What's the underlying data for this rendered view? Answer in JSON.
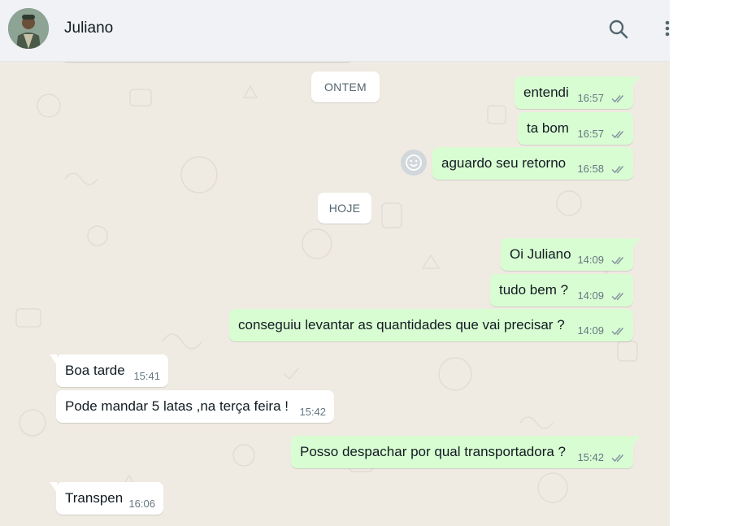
{
  "header": {
    "contact_name": "Juliano"
  },
  "icons": {
    "search": "search-icon",
    "menu": "kebab-menu-icon",
    "read_receipt": "double-check-icon",
    "emoji": "smiley-icon"
  },
  "colors": {
    "outgoing_bubble": "#d9fdd3",
    "incoming_bubble": "#ffffff",
    "chat_background": "#efeae2",
    "header_background": "#f0f2f5",
    "read_check": "#8696a0"
  },
  "dates": {
    "yesterday": "ONTEM",
    "today": "HOJE"
  },
  "messages": [
    {
      "direction": "out",
      "text": "entendi",
      "time": "16:57",
      "status": "read"
    },
    {
      "direction": "out",
      "text": "ta bom",
      "time": "16:57",
      "status": "read"
    },
    {
      "direction": "out",
      "text": "aguardo seu retorno",
      "time": "16:58",
      "status": "read"
    },
    {
      "direction": "out",
      "text": "Oi Juliano",
      "time": "14:09",
      "status": "read"
    },
    {
      "direction": "out",
      "text": "tudo bem ?",
      "time": "14:09",
      "status": "read"
    },
    {
      "direction": "out",
      "text": "conseguiu levantar as quantidades que vai precisar ?",
      "time": "14:09",
      "status": "read"
    },
    {
      "direction": "in",
      "text": "Boa tarde",
      "time": "15:41"
    },
    {
      "direction": "in",
      "text": "Pode mandar 5 latas ,na terça feira !",
      "time": "15:42"
    },
    {
      "direction": "out",
      "text": "Posso despachar por qual transportadora ?",
      "time": "15:42",
      "status": "read"
    },
    {
      "direction": "in",
      "text": "Transpen",
      "time": "16:06"
    }
  ]
}
